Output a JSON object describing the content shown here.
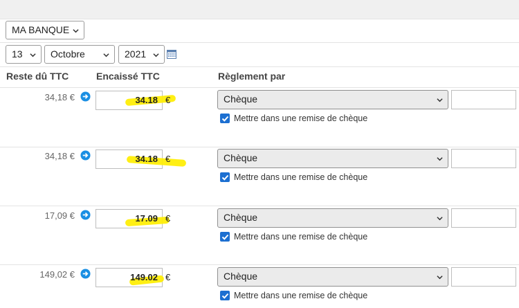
{
  "bank_select": {
    "value": "MA BANQUE"
  },
  "date": {
    "day": "13",
    "month": "Octobre",
    "year": "2021"
  },
  "headers": {
    "due": "Reste dû TTC",
    "collected": "Encaissé TTC",
    "payment": "Règlement par"
  },
  "currency": "€",
  "colors": {
    "highlight": "#ffee00",
    "checkbox": "#1c6fd1",
    "arrow": "#1a8fe3"
  },
  "rows": [
    {
      "due": "34,18 €",
      "collected": "34.18",
      "payment": "Chèque",
      "remise_label": "Mettre dans une remise de chèque",
      "remise_checked": true
    },
    {
      "due": "34,18 €",
      "collected": "34.18",
      "payment": "Chèque",
      "remise_label": "Mettre dans une remise de chèque",
      "remise_checked": true
    },
    {
      "due": "17,09 €",
      "collected": "17.09",
      "payment": "Chèque",
      "remise_label": "Mettre dans une remise de chèque",
      "remise_checked": true
    },
    {
      "due": "149,02 €",
      "collected": "149.02",
      "payment": "Chèque",
      "remise_label": "Mettre dans une remise de chèque",
      "remise_checked": true
    }
  ]
}
